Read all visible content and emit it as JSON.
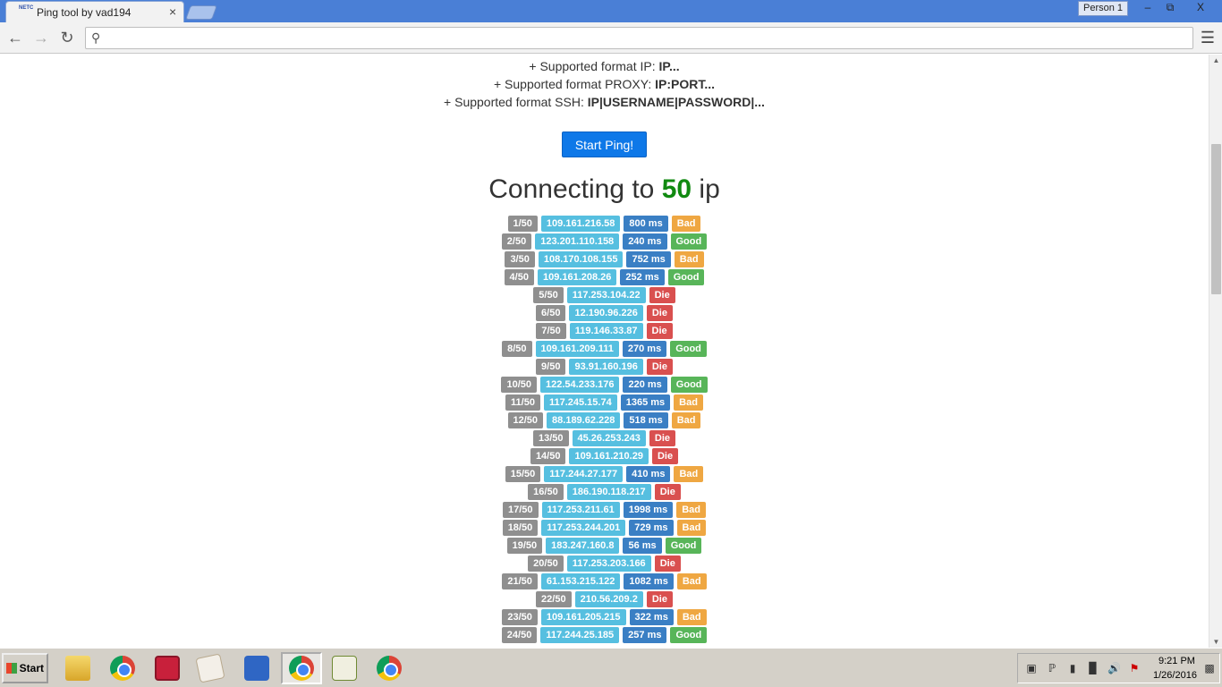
{
  "window": {
    "tab_title": "Ping tool by vad194",
    "favicon": "NETC",
    "tab_close_icon": "close-icon",
    "profile_button": "Person 1",
    "minimize_glyph": "–",
    "restore_glyph": "⧉",
    "close_glyph": "X"
  },
  "toolbar": {
    "back_icon": "back-arrow-icon",
    "forward_icon": "forward-arrow-icon",
    "reload_icon": "reload-icon",
    "address_value": "",
    "address_placeholder": "",
    "search_icon": "search-icon",
    "menu_icon": "hamburger-menu-icon"
  },
  "page": {
    "formats": [
      {
        "prefix": "+ Supported format IP: ",
        "value": "IP..."
      },
      {
        "prefix": "+ Supported format PROXY: ",
        "value": "IP:PORT..."
      },
      {
        "prefix": "+ Supported format SSH: ",
        "value": "IP|USERNAME|PASSWORD|..."
      }
    ],
    "start_button": "Start Ping!",
    "heading_prefix": "Connecting to ",
    "heading_count": "50",
    "heading_suffix": " ip",
    "colors": {
      "count_green": "#118a11",
      "button_blue": "#0e78e8",
      "good": "#58b559",
      "bad": "#efa742",
      "die": "#d9504f",
      "ip": "#56bfe0",
      "ms": "#3a7fc4",
      "index": "#8f8f8f"
    },
    "results": [
      {
        "index": "1/50",
        "ip": "109.161.216.58",
        "ms": "800 ms",
        "status": "Bad"
      },
      {
        "index": "2/50",
        "ip": "123.201.110.158",
        "ms": "240 ms",
        "status": "Good"
      },
      {
        "index": "3/50",
        "ip": "108.170.108.155",
        "ms": "752 ms",
        "status": "Bad"
      },
      {
        "index": "4/50",
        "ip": "109.161.208.26",
        "ms": "252 ms",
        "status": "Good"
      },
      {
        "index": "5/50",
        "ip": "117.253.104.22",
        "ms": "",
        "status": "Die"
      },
      {
        "index": "6/50",
        "ip": "12.190.96.226",
        "ms": "",
        "status": "Die"
      },
      {
        "index": "7/50",
        "ip": "119.146.33.87",
        "ms": "",
        "status": "Die"
      },
      {
        "index": "8/50",
        "ip": "109.161.209.111",
        "ms": "270 ms",
        "status": "Good"
      },
      {
        "index": "9/50",
        "ip": "93.91.160.196",
        "ms": "",
        "status": "Die"
      },
      {
        "index": "10/50",
        "ip": "122.54.233.176",
        "ms": "220 ms",
        "status": "Good"
      },
      {
        "index": "11/50",
        "ip": "117.245.15.74",
        "ms": "1365 ms",
        "status": "Bad"
      },
      {
        "index": "12/50",
        "ip": "88.189.62.228",
        "ms": "518 ms",
        "status": "Bad"
      },
      {
        "index": "13/50",
        "ip": "45.26.253.243",
        "ms": "",
        "status": "Die"
      },
      {
        "index": "14/50",
        "ip": "109.161.210.29",
        "ms": "",
        "status": "Die"
      },
      {
        "index": "15/50",
        "ip": "117.244.27.177",
        "ms": "410 ms",
        "status": "Bad"
      },
      {
        "index": "16/50",
        "ip": "186.190.118.217",
        "ms": "",
        "status": "Die"
      },
      {
        "index": "17/50",
        "ip": "117.253.211.61",
        "ms": "1998 ms",
        "status": "Bad"
      },
      {
        "index": "18/50",
        "ip": "117.253.244.201",
        "ms": "729 ms",
        "status": "Bad"
      },
      {
        "index": "19/50",
        "ip": "183.247.160.8",
        "ms": "56 ms",
        "status": "Good"
      },
      {
        "index": "20/50",
        "ip": "117.253.203.166",
        "ms": "",
        "status": "Die"
      },
      {
        "index": "21/50",
        "ip": "61.153.215.122",
        "ms": "1082 ms",
        "status": "Bad"
      },
      {
        "index": "22/50",
        "ip": "210.56.209.2",
        "ms": "",
        "status": "Die"
      },
      {
        "index": "23/50",
        "ip": "109.161.205.215",
        "ms": "322 ms",
        "status": "Bad"
      },
      {
        "index": "24/50",
        "ip": "117.244.25.185",
        "ms": "257 ms",
        "status": "Good"
      }
    ]
  },
  "taskbar": {
    "start_label": "Start",
    "apps": [
      {
        "name": "file-explorer-icon",
        "active": false
      },
      {
        "name": "chrome-icon",
        "active": false
      },
      {
        "name": "target-app-icon",
        "active": false
      },
      {
        "name": "image-viewer-icon",
        "active": false
      },
      {
        "name": "app-icon",
        "active": false
      },
      {
        "name": "chrome-icon",
        "active": true
      },
      {
        "name": "notepad-icon",
        "active": false
      },
      {
        "name": "chrome-icon",
        "active": false
      }
    ],
    "tray_icons": [
      "e-icon",
      "bluetooth-icon",
      "battery-icon",
      "signal-icon",
      "volume-icon",
      "flag-icon"
    ],
    "time": "9:21 PM",
    "date": "1/26/2016"
  }
}
